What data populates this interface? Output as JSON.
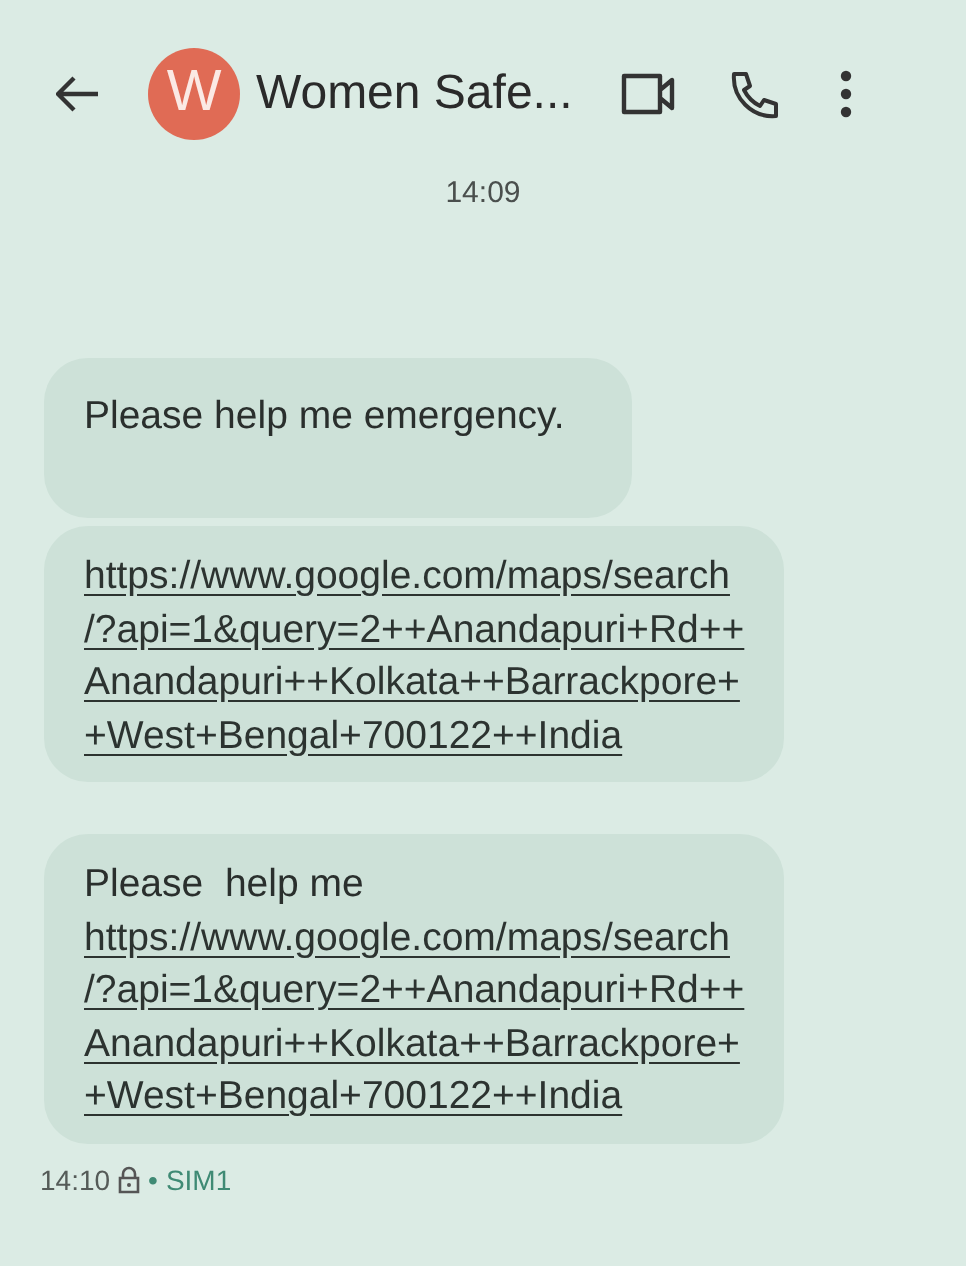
{
  "header": {
    "avatar_letter": "W",
    "title": "Women Safe..."
  },
  "date_stamp": "14:09",
  "messages": [
    {
      "text": "Please help me emergency."
    },
    {
      "link_lines": [
        "https://www.google.com/maps/search",
        "/?api=1&query=2++Anandapuri+Rd++",
        "Anandapuri++Kolkata++Barrackpore+",
        "+West+Bengal+700122++India"
      ]
    },
    {
      "text": "Please  help me",
      "link_lines": [
        "https://www.google.com/maps/search",
        "/?api=1&query=2++Anandapuri+Rd++",
        "Anandapuri++Kolkata++Barrackpore+",
        "+West+Bengal+700122++India"
      ]
    }
  ],
  "footer": {
    "time": "14:10",
    "separator": "•",
    "sim": "SIM1"
  }
}
